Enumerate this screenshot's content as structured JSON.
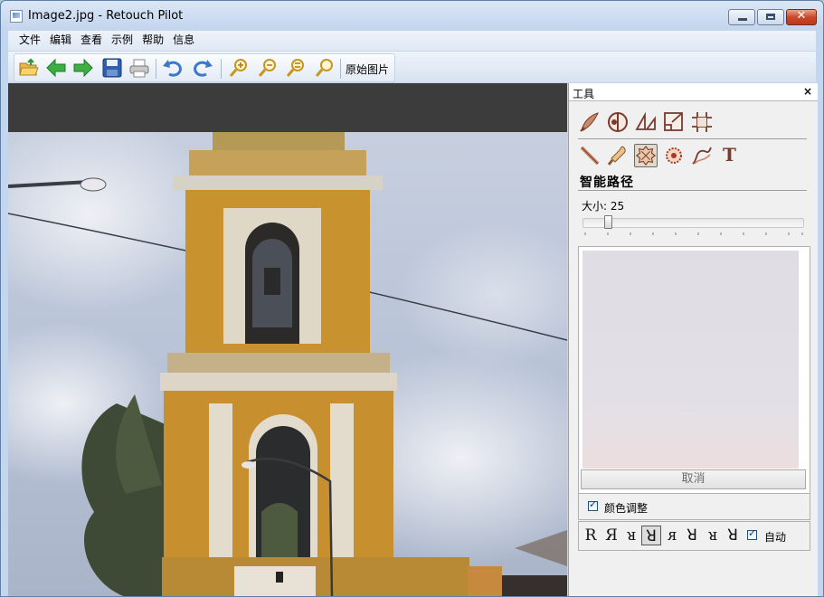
{
  "window": {
    "title": "Image2.jpg - Retouch Pilot",
    "controls": {
      "close_glyph": "✕"
    }
  },
  "menu": [
    "文件",
    "编辑",
    "查看",
    "示例",
    "帮助",
    "信息"
  ],
  "toolbar": {
    "buttons": [
      "open-icon",
      "back-icon",
      "forward-icon",
      "save-icon",
      "print-icon",
      "undo-icon",
      "redo-icon",
      "zoom-in-icon",
      "zoom-out-icon",
      "zoom-fit-icon",
      "zoom-actual-icon"
    ],
    "original_label": "原始图片"
  },
  "tools_panel": {
    "title": "工具",
    "close_glyph": "×",
    "row1_tools": [
      "brush-tool-icon",
      "color-wheel-icon",
      "perspective-icon",
      "crop-icon",
      "grid-icon"
    ],
    "row2_tools": [
      "pencil-icon",
      "paint-brush-icon",
      "smart-path-icon",
      "stamp-icon",
      "curve-icon",
      "text-icon"
    ],
    "text_tool_glyph": "T",
    "selected_tool": "smart-path-icon",
    "section_title": "智能路径",
    "size_label": "大小: 25",
    "size_value": 25,
    "cancel_label": "取消",
    "color_adjust_label": "颜色调整",
    "color_adjust_checked": true,
    "shapes": [
      "R",
      "Я",
      "ᴚ",
      "ꓤ",
      "ᴙ",
      "ꓤ",
      "ᴚ",
      "ꓤ"
    ],
    "selected_shape_index": 3,
    "auto_label": "自动",
    "auto_checked": true
  }
}
